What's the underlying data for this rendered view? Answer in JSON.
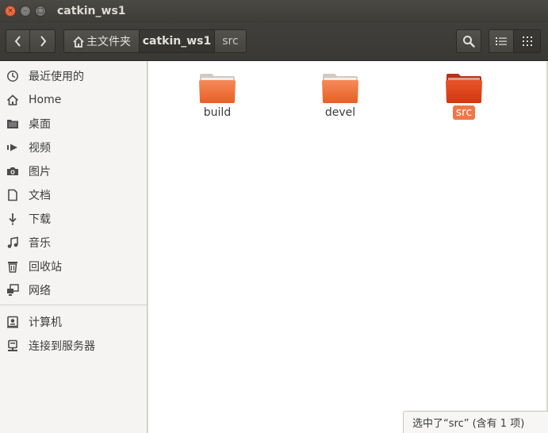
{
  "window": {
    "title": "catkin_ws1",
    "close_glyph": "×",
    "minimize_glyph": "–",
    "maximize_glyph": "□"
  },
  "toolbar": {
    "back_icon": "chevron-left-icon",
    "forward_icon": "chevron-right-icon",
    "path": [
      {
        "label": "主文件夹",
        "icon": "home-icon"
      },
      {
        "label": "catkin_ws1"
      },
      {
        "label": "src"
      }
    ],
    "search_icon": "search-icon",
    "list_view_icon": "list-view-icon",
    "grid_view_icon": "grid-view-icon"
  },
  "sidebar": {
    "items": [
      {
        "label": "最近使用的",
        "icon": "clock-icon"
      },
      {
        "label": "Home",
        "icon": "home-icon"
      },
      {
        "label": "桌面",
        "icon": "folder-icon"
      },
      {
        "label": "视频",
        "icon": "video-icon"
      },
      {
        "label": "图片",
        "icon": "camera-icon"
      },
      {
        "label": "文档",
        "icon": "document-icon"
      },
      {
        "label": "下载",
        "icon": "download-icon"
      },
      {
        "label": "音乐",
        "icon": "music-icon"
      },
      {
        "label": "回收站",
        "icon": "trash-icon"
      },
      {
        "label": "网络",
        "icon": "network-icon"
      },
      {
        "label": "计算机",
        "icon": "computer-icon"
      },
      {
        "label": "连接到服务器",
        "icon": "server-icon"
      }
    ]
  },
  "main": {
    "folders": [
      {
        "label": "build",
        "selected": false
      },
      {
        "label": "devel",
        "selected": false
      },
      {
        "label": "src",
        "selected": true
      }
    ]
  },
  "status": {
    "text": "选中了“src” (含有 1 项)"
  },
  "colors": {
    "accent": "#f07746",
    "titlebar": "#3d3c38",
    "folder_orange": "#f07746",
    "folder_selected": "#e0471c"
  }
}
